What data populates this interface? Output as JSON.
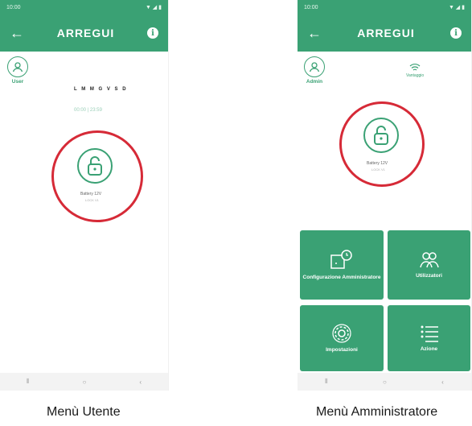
{
  "user_screen": {
    "status": {
      "time": "10:00",
      "right": "▼ ◢ ▮"
    },
    "appbar": {
      "back_icon": "arrow-left-icon",
      "brand": "ARREGUI",
      "info_icon": "info-icon"
    },
    "profile": {
      "label": "User"
    },
    "days": "L M M G V S D",
    "hours": "00:00 | 23:59",
    "lock": {
      "label": "Battery 12V",
      "sub": "LOCK V1"
    },
    "nav": {
      "recents": "⦀",
      "home": "○",
      "back": "‹"
    }
  },
  "admin_screen": {
    "status": {
      "time": "10:00",
      "right": "▼ ◢ ▮"
    },
    "appbar": {
      "back_icon": "arrow-left-icon",
      "brand": "ARREGUI",
      "info_icon": "info-icon"
    },
    "profile": {
      "label": "Admin"
    },
    "wifi": {
      "label": "Vantaggio"
    },
    "lock": {
      "label": "Battery 12V",
      "sub": "LOCK V1"
    },
    "tiles": [
      {
        "label": "Configurazione Amministratore",
        "icon": "clock-settings-icon"
      },
      {
        "label": "Utilizzatori",
        "icon": "users-icon"
      },
      {
        "label": "Impostazioni",
        "icon": "gear-icon"
      },
      {
        "label": "Azione",
        "icon": "list-icon"
      }
    ],
    "nav": {
      "recents": "⦀",
      "home": "○",
      "back": "‹"
    }
  },
  "captions": {
    "user": "Menù Utente",
    "admin": "Menù Amministratore"
  },
  "colors": {
    "brand_green": "#3aa174",
    "highlight_red": "#d62a37"
  }
}
